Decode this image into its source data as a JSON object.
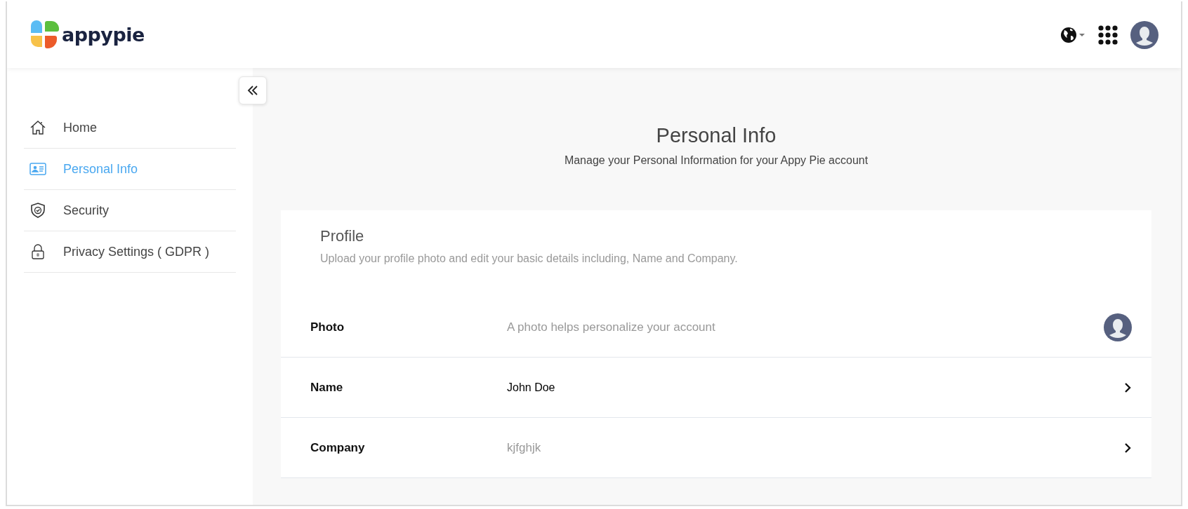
{
  "header": {
    "logo_text": "appypie"
  },
  "sidebar": {
    "items": [
      {
        "label": "Home",
        "selected": false
      },
      {
        "label": "Personal Info",
        "selected": true
      },
      {
        "label": "Security",
        "selected": false
      },
      {
        "label": "Privacy Settings ( GDPR )",
        "selected": false
      }
    ]
  },
  "page": {
    "title": "Personal Info",
    "subtitle": "Manage your Personal Information for your Appy Pie account"
  },
  "card": {
    "title": "Profile",
    "description": "Upload your profile photo and edit your basic details including, Name and Company.",
    "rows": [
      {
        "kind": "photo",
        "label": "Photo",
        "value": "A photo helps personalize your account",
        "muted": true
      },
      {
        "kind": "field",
        "label": "Name",
        "value": "John Doe",
        "muted": false
      },
      {
        "kind": "field",
        "label": "Company",
        "value": "kjfghjk",
        "muted": true
      }
    ]
  }
}
